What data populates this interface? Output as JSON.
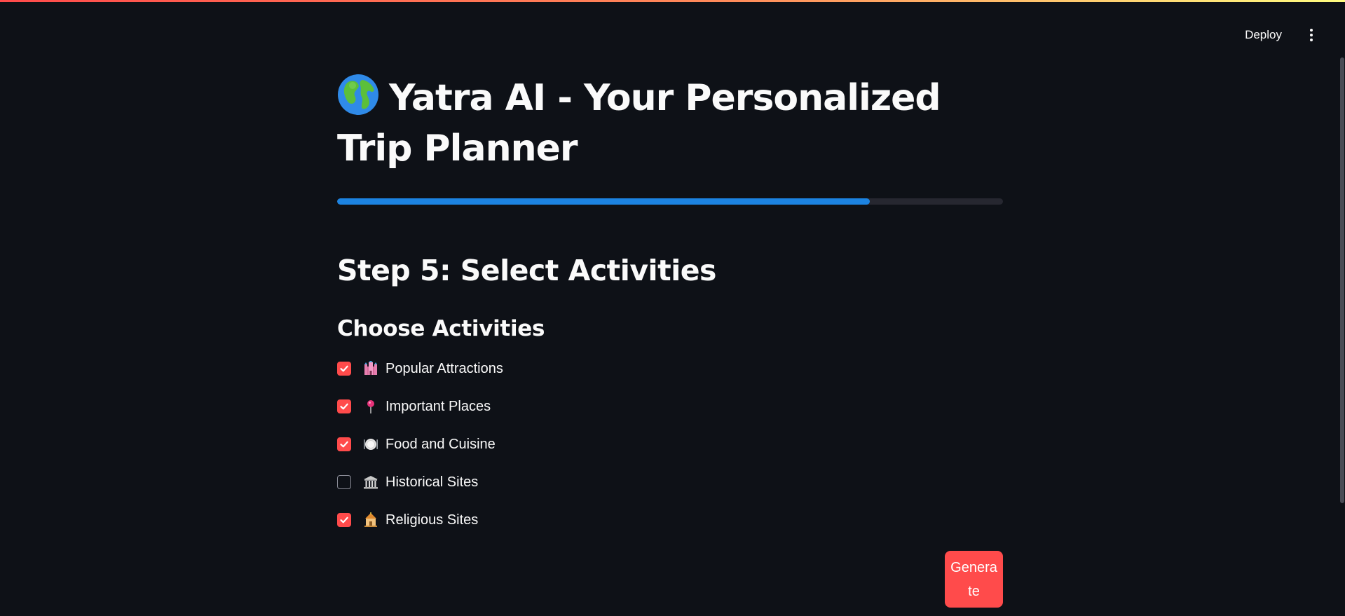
{
  "header": {
    "deploy_label": "Deploy",
    "menu_icon": "kebab-menu-icon"
  },
  "page": {
    "title": "Yatra AI - Your Personalized Trip Planner",
    "title_icon": "globe-icon"
  },
  "progress": {
    "value": 0.8,
    "color": "#1c83e1",
    "track_color": "#262730"
  },
  "step": {
    "heading": "Step 5: Select Activities"
  },
  "activities": {
    "heading": "Choose Activities",
    "items": [
      {
        "label": "Popular Attractions",
        "icon": "castle-icon",
        "checked": true
      },
      {
        "label": "Important Places",
        "icon": "pin-icon",
        "checked": true
      },
      {
        "label": "Food and Cuisine",
        "icon": "plate-icon",
        "checked": true
      },
      {
        "label": "Historical Sites",
        "icon": "classical-building-icon",
        "checked": false
      },
      {
        "label": "Religious Sites",
        "icon": "temple-icon",
        "checked": true
      }
    ]
  },
  "actions": {
    "generate_label": "Generate"
  },
  "colors": {
    "background": "#0e1117",
    "accent": "#ff4b4b",
    "text": "#fafafa"
  }
}
